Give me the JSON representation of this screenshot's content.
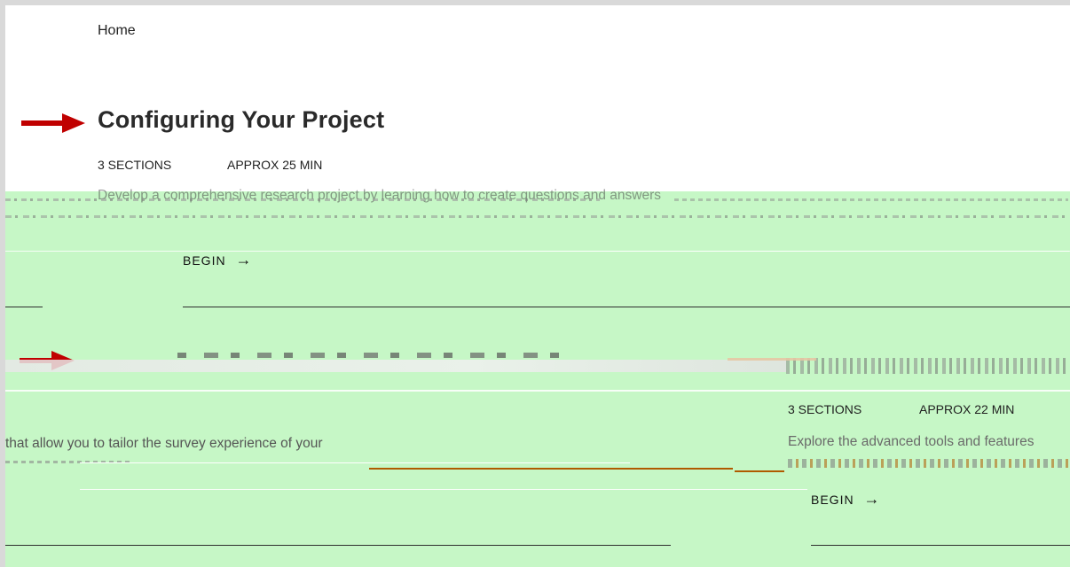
{
  "breadcrumb": {
    "home": "Home"
  },
  "course1": {
    "title": "Configuring Your Project",
    "sections": "3 SECTIONS",
    "duration": "APPROX 25 MIN",
    "description": "Develop a comprehensive research project by learning how to create questions and answers",
    "begin": "BEGIN",
    "begin_arrow": "→"
  },
  "course2": {
    "sections": "3 SECTIONS",
    "duration": "APPROX 22 MIN",
    "description_left": "that allow you to tailor the survey experience of your",
    "description_right": "Explore the advanced tools and features",
    "begin": "BEGIN",
    "begin_arrow": "→"
  },
  "colors": {
    "marker_red": "#c00000",
    "overlay_green": "#c6f7c6",
    "rule": "#2e2e2e",
    "noise_orange": "#b05a00"
  }
}
